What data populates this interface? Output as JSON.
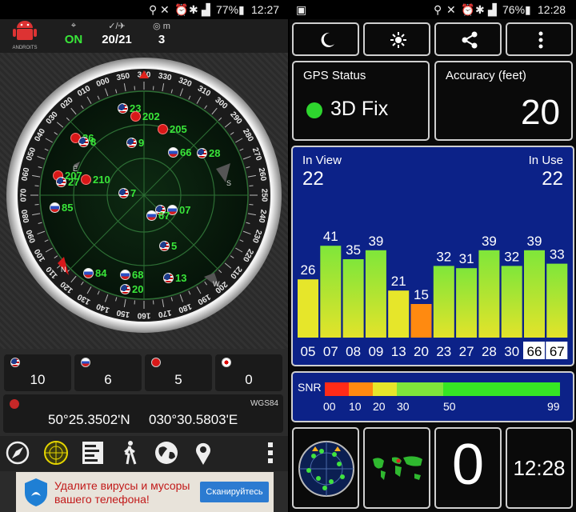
{
  "status_left": {
    "battery": "77%",
    "time": "12:27"
  },
  "status_right": {
    "battery": "76%",
    "time": "12:28"
  },
  "left_header": {
    "logo_text": "ANDROITS",
    "stats": [
      {
        "name": "gps-state",
        "value": "ON",
        "color": "#39e639"
      },
      {
        "name": "sats-used",
        "value": "20/21",
        "color": "#ffffff"
      },
      {
        "name": "meters",
        "value": "3",
        "color": "#ffffff",
        "unit": "m"
      }
    ]
  },
  "radar": {
    "north_mark": "N",
    "letters": [
      "E",
      "S",
      "W",
      "N"
    ],
    "bezel_marks": [
      "340",
      "330",
      "320",
      "310",
      "300",
      "290",
      "280",
      "270",
      "260",
      "250",
      "240",
      "230",
      "220",
      "210",
      "200",
      "190",
      "180",
      "170",
      "160",
      "150",
      "140",
      "130",
      "120",
      "110",
      "100",
      "090",
      "080",
      "070",
      "060",
      "050",
      "040",
      "030",
      "020",
      "010",
      "000",
      "350"
    ],
    "satellites": [
      {
        "id": "23",
        "flag": "us"
      },
      {
        "id": "202",
        "flag": "cn"
      },
      {
        "id": "205",
        "flag": "cn"
      },
      {
        "id": "26",
        "flag": "cn"
      },
      {
        "id": "8",
        "flag": "us"
      },
      {
        "id": "9",
        "flag": "us"
      },
      {
        "id": "66",
        "flag": "ru"
      },
      {
        "id": "28",
        "flag": "us"
      },
      {
        "id": "207",
        "flag": "cn"
      },
      {
        "id": "27",
        "flag": "us"
      },
      {
        "id": "210",
        "flag": "cn"
      },
      {
        "id": "7",
        "flag": "us"
      },
      {
        "id": "85",
        "flag": "ru"
      },
      {
        "id": "07",
        "flag": "us"
      },
      {
        "id": "67",
        "flag": "ru"
      },
      {
        "id": "5",
        "flag": "us"
      },
      {
        "id": "84",
        "flag": "ru"
      },
      {
        "id": "68",
        "flag": "ru"
      },
      {
        "id": "20",
        "flag": "us"
      },
      {
        "id": "13",
        "flag": "us"
      }
    ]
  },
  "counts": [
    {
      "flag": "us",
      "value": "10"
    },
    {
      "flag": "ru",
      "value": "6"
    },
    {
      "flag": "cn",
      "value": "5"
    },
    {
      "flag": "jp",
      "value": "0"
    }
  ],
  "coords": {
    "lat": "50°25.3502'N",
    "lon": "030°30.5803'E",
    "datum": "WGS84"
  },
  "toolbar": [
    "compass-icon",
    "radar-icon",
    "list-icon",
    "walker-icon",
    "globe-icon",
    "pin-icon",
    "more-vert-icon"
  ],
  "ad": {
    "line1": "Удалите вирусы и мусоры",
    "line2": "вашего телефона!",
    "button": "Сканируйтесь"
  },
  "right_toolbar": [
    "moon-icon",
    "sun-icon",
    "share-icon",
    "more-vert-icon"
  ],
  "gps_status": {
    "label": "GPS Status",
    "value": "3D Fix",
    "color": "#2ed52e"
  },
  "accuracy": {
    "label": "Accuracy (feet)",
    "value": "20"
  },
  "in_view": {
    "label": "In View",
    "value": "22"
  },
  "in_use": {
    "label": "In Use",
    "value": "22"
  },
  "chart_data": {
    "type": "bar",
    "categories": [
      "05",
      "07",
      "08",
      "09",
      "13",
      "20",
      "23",
      "27",
      "28",
      "30",
      "66",
      "67"
    ],
    "values": [
      26,
      41,
      35,
      39,
      21,
      15,
      32,
      31,
      39,
      32,
      39,
      33
    ],
    "ylim": [
      0,
      99
    ],
    "highlighted": [
      "66",
      "67"
    ]
  },
  "snr_scale": {
    "label": "SNR",
    "ticks": [
      "00",
      "10",
      "20",
      "30",
      "50",
      "99"
    ],
    "colors": [
      "#ff2b18",
      "#ff8a10",
      "#e6e62a",
      "#7fe63a",
      "#36e624"
    ]
  },
  "bottom": {
    "count": "0",
    "clock": "12:28"
  }
}
